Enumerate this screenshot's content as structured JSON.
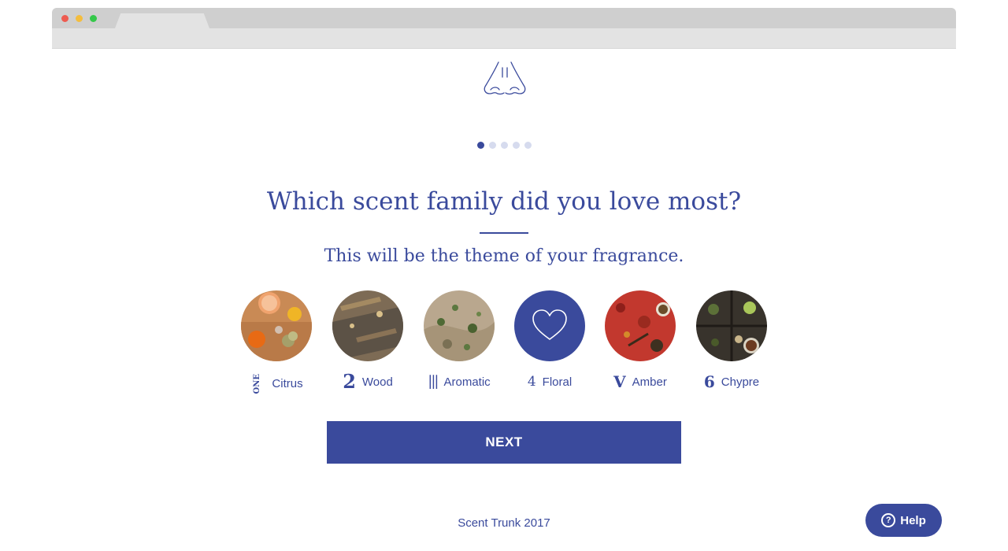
{
  "colors": {
    "brand": "#3a4a9c",
    "dot_inactive": "#d6dbee"
  },
  "logo": {
    "icon": "nose-icon"
  },
  "progress": {
    "total_steps": 5,
    "current_step": 1
  },
  "question": "Which scent family did you love most?",
  "subtitle": "This will be the theme of your fragrance.",
  "options": [
    {
      "numeral": "ONE",
      "label": "Citrus",
      "icon": "citrus-image",
      "selected": false
    },
    {
      "numeral": "2",
      "label": "Wood",
      "icon": "wood-image",
      "selected": false
    },
    {
      "numeral": "|||",
      "label": "Aromatic",
      "icon": "aromatic-image",
      "selected": false
    },
    {
      "numeral": "4",
      "label": "Floral",
      "icon": "heart-icon",
      "selected": true
    },
    {
      "numeral": "V",
      "label": "Amber",
      "icon": "amber-image",
      "selected": false
    },
    {
      "numeral": "6",
      "label": "Chypre",
      "icon": "chypre-image",
      "selected": false
    }
  ],
  "next_label": "NEXT",
  "footer": "Scent Trunk 2017",
  "help": {
    "label": "Help",
    "icon_glyph": "?"
  }
}
